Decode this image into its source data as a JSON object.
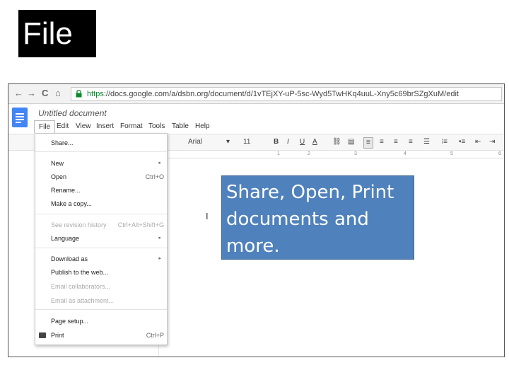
{
  "slide": {
    "title": "File",
    "callout_text": "Share, Open, Print documents and more."
  },
  "browser": {
    "back_icon": "←",
    "forward_icon": "→",
    "reload_icon": "C",
    "home_icon": "⌂",
    "url_scheme": "https",
    "url_rest": "://docs.google.com/a/dsbn.org/document/d/1vTEjXY-uP-5sc-Wyd5TwHKq4uuL-Xny5c69brSZgXuM/edit"
  },
  "docs": {
    "title": "Untitled document",
    "menu": [
      "File",
      "Edit",
      "View",
      "Insert",
      "Format",
      "Tools",
      "Table",
      "Help"
    ]
  },
  "toolbar": {
    "font": "Arial",
    "size": "11",
    "bold": "B",
    "italic": "I",
    "underline": "U",
    "text_color": "A",
    "ruler_ticks": [
      "1",
      "2",
      "3",
      "4",
      "5",
      "6"
    ]
  },
  "file_menu": {
    "items": [
      {
        "label": "Share...",
        "shortcut": "",
        "submenu": false,
        "disabled": false
      },
      {
        "label": "New",
        "shortcut": "",
        "submenu": true,
        "disabled": false
      },
      {
        "label": "Open",
        "shortcut": "Ctrl+O",
        "submenu": false,
        "disabled": false
      },
      {
        "label": "Rename...",
        "shortcut": "",
        "submenu": false,
        "disabled": false
      },
      {
        "label": "Make a copy...",
        "shortcut": "",
        "submenu": false,
        "disabled": false
      },
      {
        "label": "See revision history",
        "shortcut": "Ctrl+Alt+Shift+G",
        "submenu": false,
        "disabled": true
      },
      {
        "label": "Language",
        "shortcut": "",
        "submenu": true,
        "disabled": false
      },
      {
        "label": "Download as",
        "shortcut": "",
        "submenu": true,
        "disabled": false
      },
      {
        "label": "Publish to the web...",
        "shortcut": "",
        "submenu": false,
        "disabled": false
      },
      {
        "label": "Email collaborators...",
        "shortcut": "",
        "submenu": false,
        "disabled": true
      },
      {
        "label": "Email as attachment...",
        "shortcut": "",
        "submenu": false,
        "disabled": true
      },
      {
        "label": "Page setup...",
        "shortcut": "",
        "submenu": false,
        "disabled": false
      },
      {
        "label": "Print",
        "shortcut": "Ctrl+P",
        "submenu": false,
        "disabled": false
      }
    ]
  },
  "colors": {
    "callout_bg": "#4f81bd",
    "docs_blue": "#4285f4",
    "https_green": "#0a8a2a"
  }
}
